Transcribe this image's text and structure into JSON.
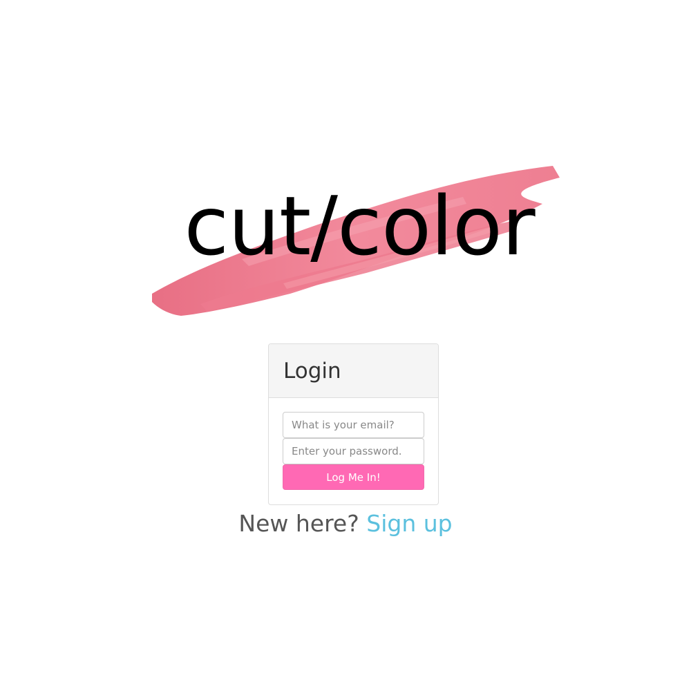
{
  "logo": {
    "text": "cut/color",
    "stroke_color": "#f07a8e"
  },
  "login": {
    "title": "Login",
    "email_placeholder": "What is your email?",
    "password_placeholder": "Enter your password.",
    "submit_label": "Log Me In!",
    "button_color": "#ff69b4"
  },
  "signup": {
    "prompt": "New here?",
    "link_label": "Sign up",
    "link_color": "#5bc0de"
  }
}
